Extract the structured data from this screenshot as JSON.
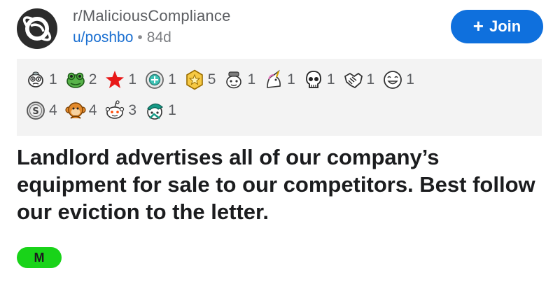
{
  "post": {
    "subreddit": "r/MaliciousCompliance",
    "author": "u/poshbo",
    "age": "84d",
    "separator": "•",
    "join_label": "Join",
    "join_icon": "plus-icon",
    "title": "Landlord advertises all of our company’s equipment for sale to our competitors. Best follow our eviction to the letter.",
    "flair": "M"
  },
  "awards": {
    "row1": [
      {
        "icon": "confused-face-icon",
        "count": "1"
      },
      {
        "icon": "frog-face-icon",
        "count": "2"
      },
      {
        "icon": "red-star-icon",
        "count": "1"
      },
      {
        "icon": "helpful-medal-icon",
        "count": "1"
      },
      {
        "icon": "gold-badge-icon",
        "count": "5"
      },
      {
        "icon": "hat-face-icon",
        "count": "1"
      },
      {
        "icon": "unicorn-icon",
        "count": "1"
      },
      {
        "icon": "skull-icon",
        "count": "1"
      },
      {
        "icon": "handshake-icon",
        "count": "1"
      },
      {
        "icon": "laughing-face-icon",
        "count": "1"
      }
    ],
    "row2": [
      {
        "icon": "silver-coin-icon",
        "count": "4"
      },
      {
        "icon": "monkey-icon",
        "count": "4"
      },
      {
        "icon": "snoo-icon",
        "count": "3"
      },
      {
        "icon": "teal-hat-face-icon",
        "count": "1"
      }
    ]
  },
  "colors": {
    "accent": "#0f70dd",
    "author_link": "#1a6fd1",
    "flair_bg": "#19d319",
    "awards_bg": "#f3f3f3"
  }
}
